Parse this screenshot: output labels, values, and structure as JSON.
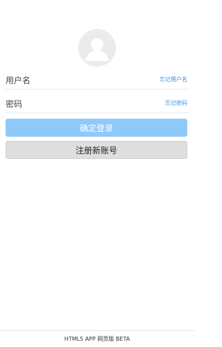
{
  "avatar": {
    "icon": "user-avatar-icon"
  },
  "username_field": {
    "placeholder": "用户名",
    "value": "",
    "forgot_link": "忘记用户名"
  },
  "password_field": {
    "placeholder": "密码",
    "value": "",
    "forgot_link": "忘记密码"
  },
  "buttons": {
    "login": "确定登录",
    "register": "注册新账号"
  },
  "footer": {
    "text": "HTML5 APP 网页版 BETA"
  },
  "colors": {
    "accent": "#3a8ee6",
    "login_button_bg": "#8fc9fa",
    "register_button_bg": "#dedede",
    "avatar_bg": "#ebebeb"
  }
}
